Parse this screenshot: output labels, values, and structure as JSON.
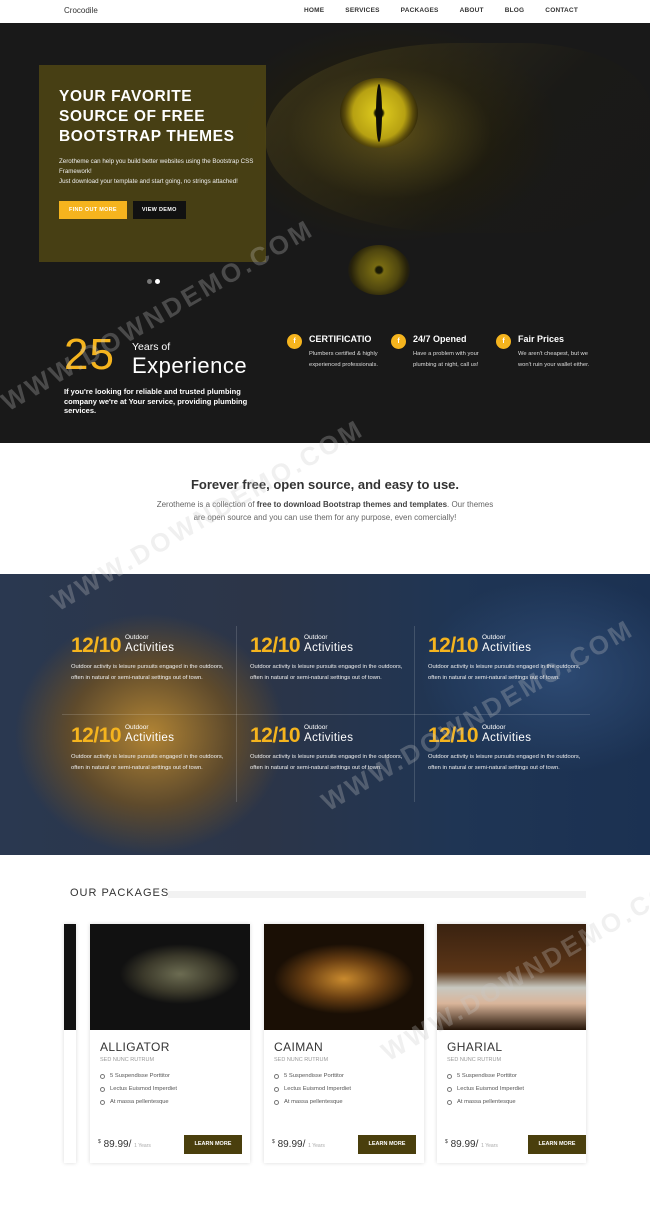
{
  "nav": {
    "brand": "Crocodile",
    "items": [
      "HOME",
      "SERVICES",
      "PACKAGES",
      "ABOUT",
      "BLOG",
      "CONTACT"
    ]
  },
  "hero": {
    "title_line1": "YOUR FAVORITE",
    "title_line2": "SOURCE OF FREE",
    "title_line3": "BOOTSTRAP THEMES",
    "text_line1": "Zerotheme can help you build better websites using the Bootstrap CSS Framework!",
    "text_line2": "Just download your template and start going, no strings attached!",
    "btn_primary": "FIND OUT MORE",
    "btn_secondary": "VIEW DEMO"
  },
  "experience": {
    "number": "25",
    "years_of": "Years of",
    "label": "Experience",
    "desc": "If you're looking for reliable and trusted plumbing company we're at Your service, providing plumbing services."
  },
  "features": [
    {
      "icon": "f",
      "title": "CERTIFICATIO",
      "desc": "Plumbers certified & highly experienced professionals."
    },
    {
      "icon": "f",
      "title": "24/7 Opened",
      "desc": "Have a problem with your plumbing at night, call us!"
    },
    {
      "icon": "f",
      "title": "Fair Prices",
      "desc": "We aren't cheapest, but we won't ruin your wallet either."
    }
  ],
  "intro": {
    "title": "Forever free, open source, and easy to use.",
    "text_pre": "Zerotheme is a collection of ",
    "text_bold": "free to download Bootstrap themes and templates",
    "text_post": ". Our themes are open source and you can use them for any purpose, even comercially!"
  },
  "activities": [
    {
      "number": "12/10",
      "small": "Outdoor",
      "big": "Activities",
      "desc": "Outdoor activity is leisure pursuits engaged in the outdoors, often in natural or semi-natural settings out of town."
    },
    {
      "number": "12/10",
      "small": "Outdoor",
      "big": "Activities",
      "desc": "Outdoor activity is leisure pursuits engaged in the outdoors, often in natural or semi-natural settings out of town."
    },
    {
      "number": "12/10",
      "small": "Outdoor",
      "big": "Activities",
      "desc": "Outdoor activity is leisure pursuits engaged in the outdoors, often in natural or semi-natural settings out of town."
    },
    {
      "number": "12/10",
      "small": "Outdoor",
      "big": "Activities",
      "desc": "Outdoor activity is leisure pursuits engaged in the outdoors, often in natural or semi-natural settings out of town."
    },
    {
      "number": "12/10",
      "small": "Outdoor",
      "big": "Activities",
      "desc": "Outdoor activity is leisure pursuits engaged in the outdoors, often in natural or semi-natural settings out of town."
    },
    {
      "number": "12/10",
      "small": "Outdoor",
      "big": "Activities",
      "desc": "Outdoor activity is leisure pursuits engaged in the outdoors, often in natural or semi-natural settings out of town."
    }
  ],
  "packages": {
    "title": "OUR PACKAGES",
    "cards": [
      {
        "name": "ALLIGATOR",
        "sub": "SED NUNC RUTRUM",
        "items": [
          "5 Suspendisse Porttitor",
          "Lectus Euismod Imperdiet",
          "At massa pellentesque"
        ],
        "currency": "$",
        "price": "89.99/",
        "unit": "1 Years",
        "button": "LEARN MORE"
      },
      {
        "name": "CAIMAN",
        "sub": "SED NUNC RUTRUM",
        "items": [
          "5 Suspendisse Porttitor",
          "Lectus Euismod Imperdiet",
          "At massa pellentesque"
        ],
        "currency": "$",
        "price": "89.99/",
        "unit": "1 Years",
        "button": "LEARN MORE"
      },
      {
        "name": "GHARIAL",
        "sub": "SED NUNC RUTRUM",
        "items": [
          "5 Suspendisse Porttitor",
          "Lectus Euismod Imperdiet",
          "At massa pellentesque"
        ],
        "currency": "$",
        "price": "89.99/",
        "unit": "1 Years",
        "button": "LEARN MORE"
      }
    ]
  },
  "watermark": "WWW.DOWNDEMO.COM",
  "colors": {
    "accent": "#f5b41e",
    "button_dark": "#4a3f0d",
    "hero_box": "#524814"
  }
}
